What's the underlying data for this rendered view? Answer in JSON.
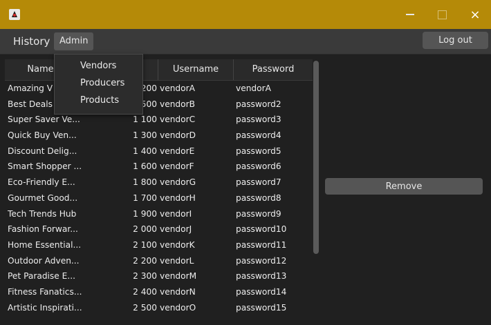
{
  "window": {
    "icon": "java-duke-icon",
    "controls": {
      "minimize": "minimize-icon",
      "maximize": "maximize-icon",
      "close": "×"
    }
  },
  "menubar": {
    "menus": [
      "History",
      "Admin"
    ],
    "logout_label": "Log out"
  },
  "admin_menu": {
    "items": [
      "Vendors",
      "Producers",
      "Products"
    ]
  },
  "table": {
    "columns": [
      "Name",
      "",
      "Username",
      "Password"
    ],
    "rows": [
      {
        "name": "Amazing V",
        "num": "200",
        "user": "vendorA",
        "pass": "vendorA"
      },
      {
        "name": "Best Deals",
        "num": "500",
        "user": "vendorB",
        "pass": "password2"
      },
      {
        "name": "Super Saver Ve...",
        "num": "1 100",
        "user": "vendorC",
        "pass": "password3"
      },
      {
        "name": "Quick Buy Ven...",
        "num": "1 300",
        "user": "vendorD",
        "pass": "password4"
      },
      {
        "name": "Discount Delig...",
        "num": "1 400",
        "user": "vendorE",
        "pass": "password5"
      },
      {
        "name": "Smart Shopper ...",
        "num": "1 600",
        "user": "vendorF",
        "pass": "password6"
      },
      {
        "name": "Eco-Friendly E...",
        "num": "1 800",
        "user": "vendorG",
        "pass": "password7"
      },
      {
        "name": "Gourmet Good...",
        "num": "1 700",
        "user": "vendorH",
        "pass": "password8"
      },
      {
        "name": "Tech Trends Hub",
        "num": "1 900",
        "user": "vendorI",
        "pass": "password9"
      },
      {
        "name": "Fashion Forwar...",
        "num": "2 000",
        "user": "vendorJ",
        "pass": "password10"
      },
      {
        "name": "Home Essential...",
        "num": "2 100",
        "user": "vendorK",
        "pass": "password11"
      },
      {
        "name": "Outdoor Adven...",
        "num": "2 200",
        "user": "vendorL",
        "pass": "password12"
      },
      {
        "name": "Pet Paradise E...",
        "num": "2 300",
        "user": "vendorM",
        "pass": "password13"
      },
      {
        "name": "Fitness Fanatics...",
        "num": "2 400",
        "user": "vendorN",
        "pass": "password14"
      },
      {
        "name": "Artistic Inspirati...",
        "num": "2 500",
        "user": "vendorO",
        "pass": "password15"
      }
    ]
  },
  "actions": {
    "remove_label": "Remove"
  },
  "colors": {
    "titlebar": "#b58a08",
    "background": "#202020",
    "button": "#555555"
  }
}
